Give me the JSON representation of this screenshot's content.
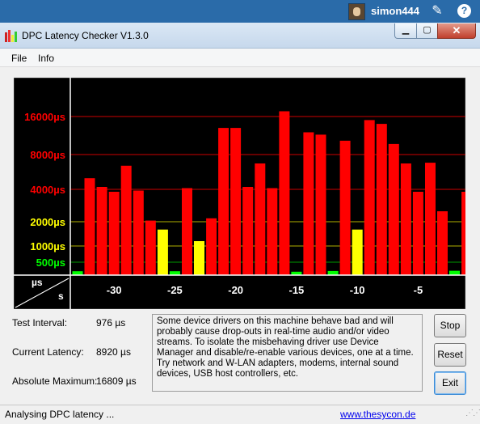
{
  "taskbar": {
    "username": "simon444"
  },
  "window": {
    "title": "DPC Latency Checker V1.3.0"
  },
  "menu": {
    "file": "File",
    "info": "Info"
  },
  "chart_data": {
    "type": "bar",
    "y_axis_labels": [
      {
        "text": "16000µs",
        "color": "#ff0000"
      },
      {
        "text": "8000µs",
        "color": "#ff0000"
      },
      {
        "text": "4000µs",
        "color": "#ff0000"
      },
      {
        "text": "2000µs",
        "color": "#ffff00"
      },
      {
        "text": "1000µs",
        "color": "#ffff00"
      },
      {
        "text": "500µs",
        "color": "#00ff00"
      }
    ],
    "x_ticks": [
      -30,
      -25,
      -20,
      -15,
      -10,
      -5
    ],
    "x_tick_labels": [
      "-30",
      "-25",
      "-20",
      "-15",
      "-10",
      "-5"
    ],
    "corner_top": "µs",
    "corner_bottom": "s",
    "grid_colors": {
      "red": "#cc0000",
      "yellow": "#b0b000",
      "green": "#009900"
    },
    "bar_colors": {
      "red": "#ff0000",
      "yellow": "#ffff00",
      "green": "#00ff00"
    },
    "x": [
      -33,
      -32,
      -31,
      -30,
      -29,
      -28,
      -27,
      -26,
      -25,
      -24,
      -23,
      -22,
      -21,
      -20,
      -19,
      -18,
      -17,
      -16,
      -15,
      -14,
      -13,
      -12,
      -11,
      -10,
      -9,
      -8,
      -7,
      -6,
      -5,
      -4,
      -3,
      -2,
      -1
    ],
    "values": [
      150,
      5000,
      4200,
      3800,
      6400,
      3900,
      2050,
      1600,
      150,
      4100,
      1150,
      2150,
      13000,
      13000,
      4200,
      6700,
      4100,
      18500,
      130,
      12000,
      11500,
      160,
      10300,
      1600,
      15000,
      14000,
      9700,
      6700,
      3800,
      6800,
      2500,
      170,
      3800
    ]
  },
  "stats": {
    "test_interval_label": "Test Interval:",
    "test_interval_value": "976 µs",
    "current_latency_label": "Current Latency:",
    "current_latency_value": "8920 µs",
    "absolute_maximum_label": "Absolute Maximum:",
    "absolute_maximum_value": "16809 µs"
  },
  "info_text": "Some device drivers on this machine behave bad and will probably cause drop-outs in real-time audio and/or video streams. To isolate the misbehaving driver use Device Manager and disable/re-enable various devices, one at a time. Try network and W-LAN adapters, modems, internal sound devices, USB host controllers, etc.",
  "buttons": {
    "stop": "Stop",
    "reset": "Reset",
    "exit": "Exit"
  },
  "status": {
    "text": "Analysing DPC latency ...",
    "link": "www.thesycon.de"
  }
}
